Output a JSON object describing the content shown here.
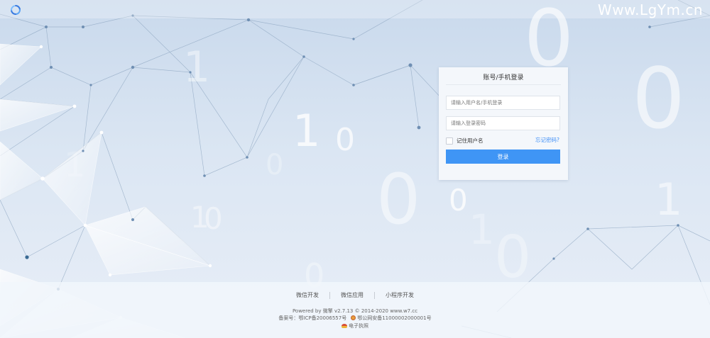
{
  "header": {
    "logo_icon": "w7-logo-icon",
    "watermark": "Www.LgYm.cn"
  },
  "login": {
    "title": "账号/手机登录",
    "username_placeholder": "请输入用户名/手机登录",
    "password_placeholder": "请输入登录密码",
    "remember_label": "记住用户名",
    "forgot_label": "忘记密码?",
    "submit_label": "登录",
    "accent_color": "#3f95f5"
  },
  "footer": {
    "links": [
      "微信开发",
      "微信应用",
      "小程序开发"
    ],
    "powered": "Powered by 微擎 v2.7.13 © 2014-2020 www.w7.cc",
    "icp": "备案号：鄂ICP备20006557号",
    "police": "鄂公网安备11000002000001号",
    "license": "电子执照"
  },
  "background_digits": [
    "1",
    "1",
    "0",
    "0",
    "0",
    "1",
    "0",
    "0",
    "0",
    "1",
    "0",
    "0",
    "0",
    "1",
    "1"
  ]
}
